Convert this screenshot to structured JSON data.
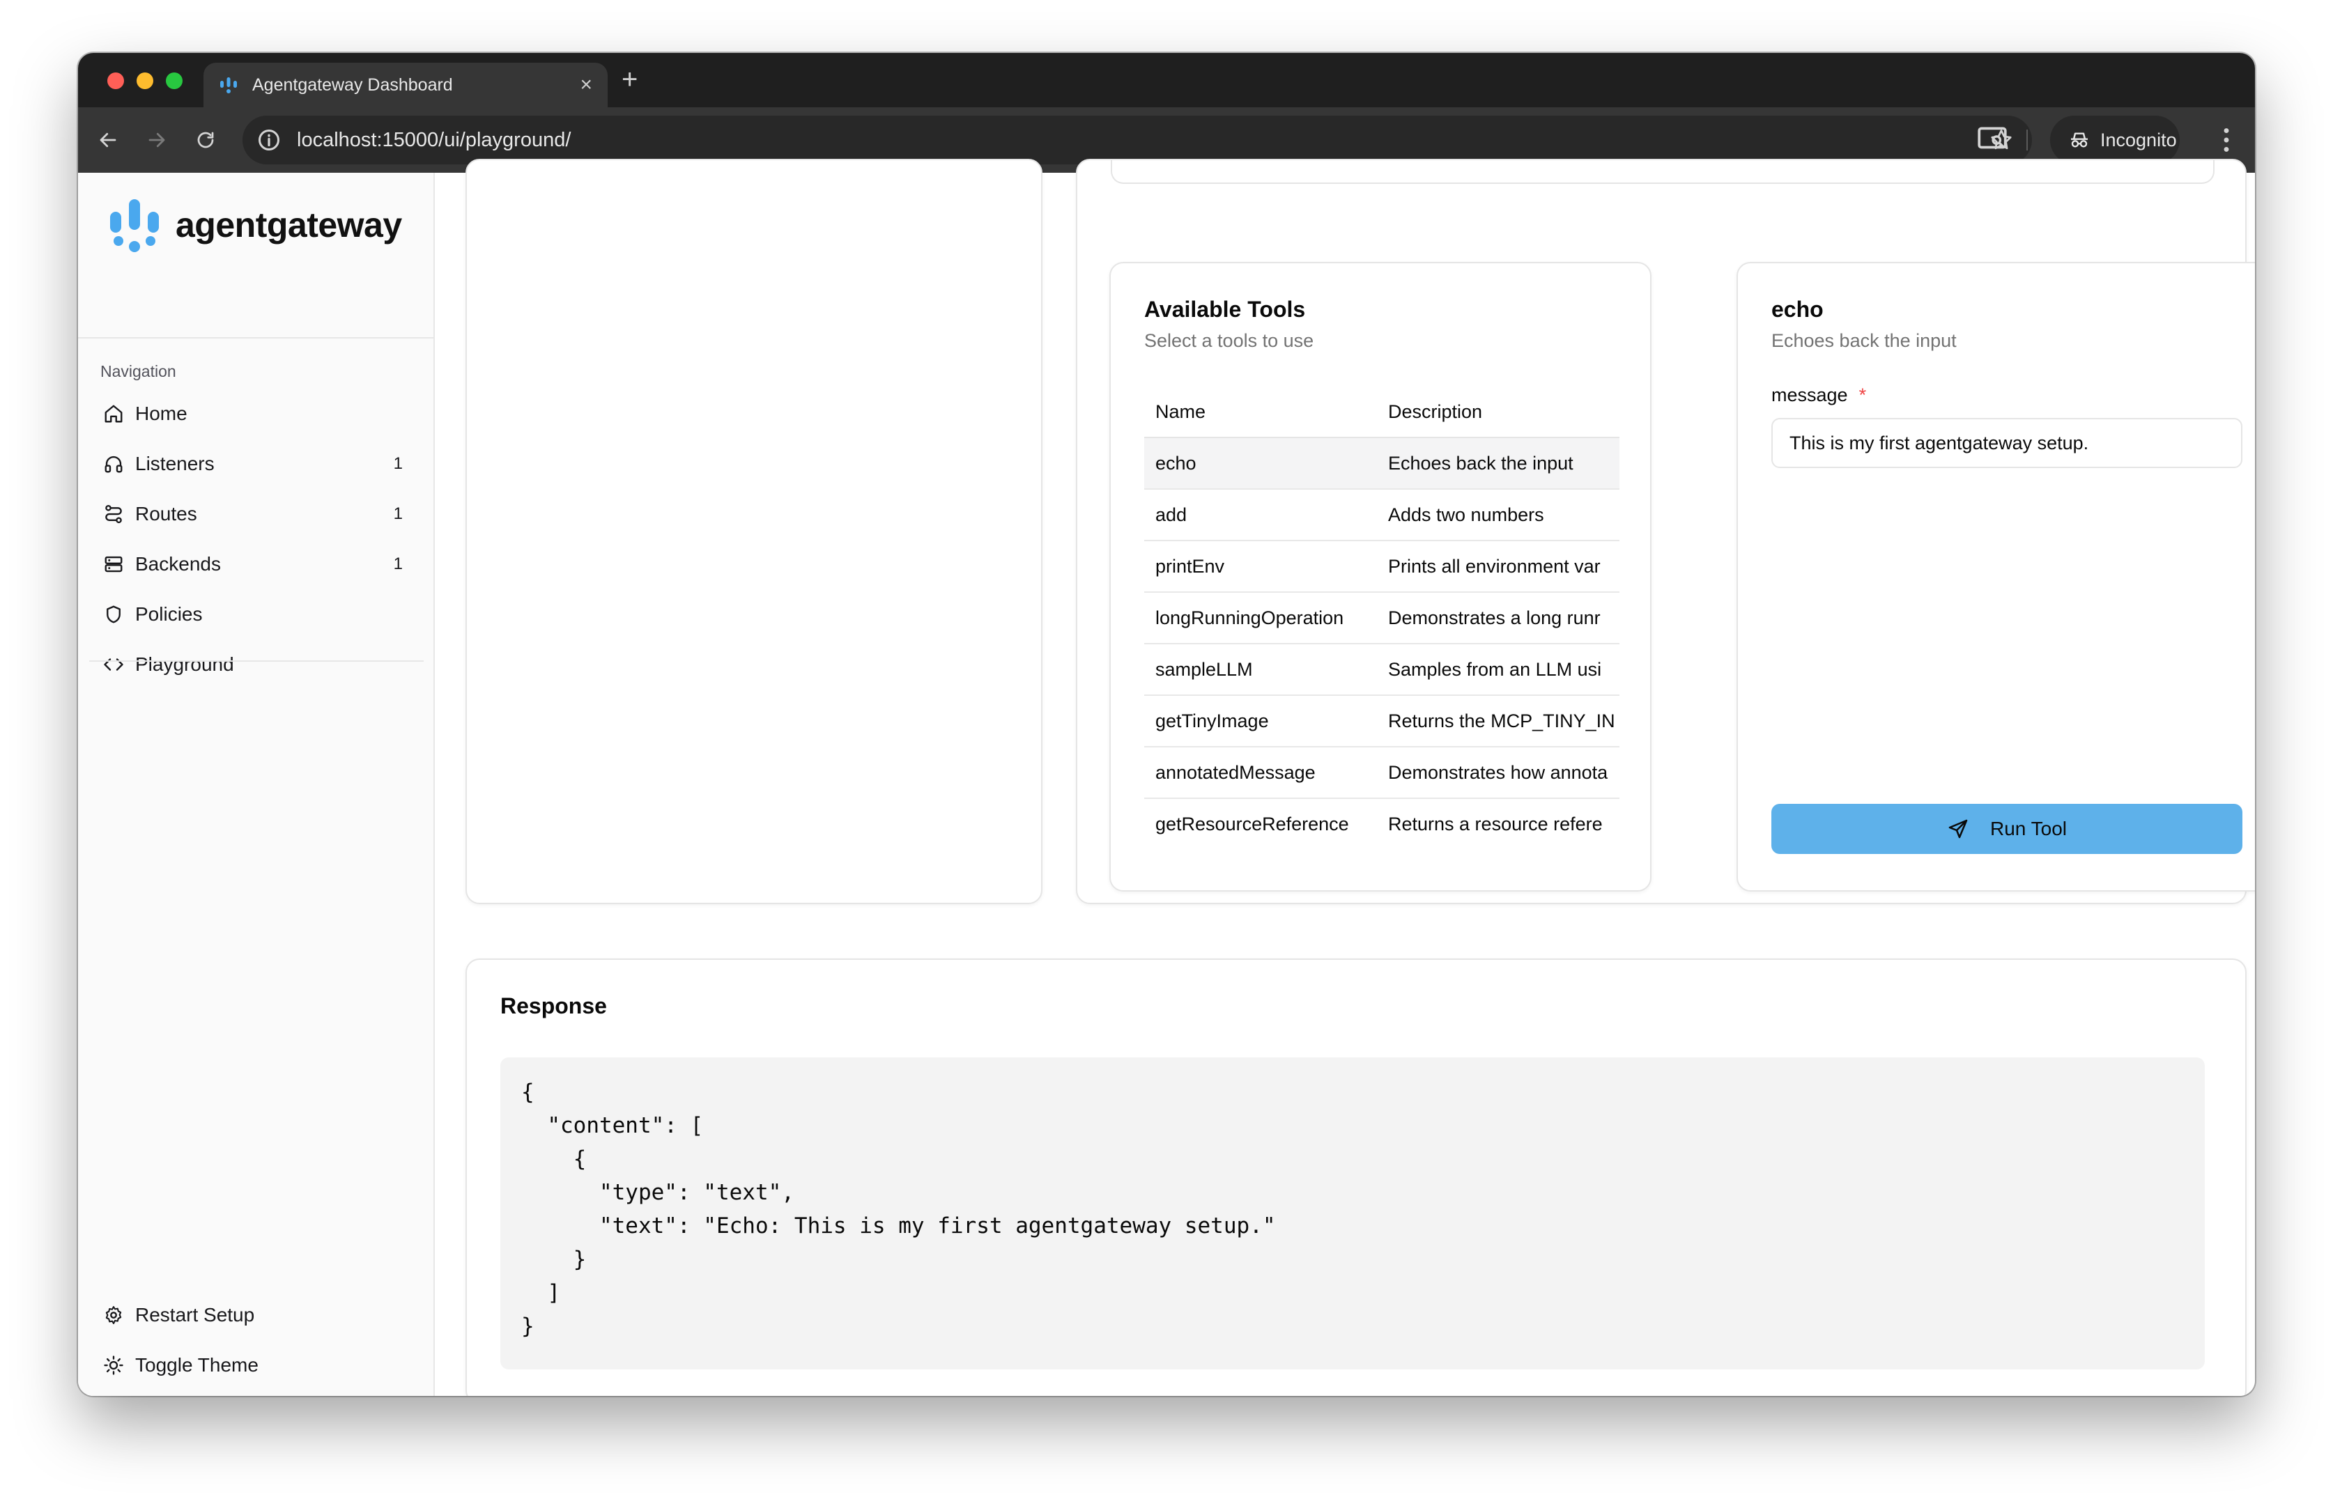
{
  "browser": {
    "tab_title": "Agentgateway Dashboard",
    "url": "localhost:15000/ui/playground/",
    "incognito_label": "Incognito"
  },
  "brand": {
    "name": "agentgateway",
    "color": "#4aa8ee"
  },
  "sidebar": {
    "section_label": "Navigation",
    "items": [
      {
        "label": "Home",
        "icon": "home-icon",
        "count": ""
      },
      {
        "label": "Listeners",
        "icon": "headphones-icon",
        "count": "1"
      },
      {
        "label": "Routes",
        "icon": "route-icon",
        "count": "1"
      },
      {
        "label": "Backends",
        "icon": "server-icon",
        "count": "1"
      },
      {
        "label": "Policies",
        "icon": "shield-icon",
        "count": ""
      },
      {
        "label": "Playground",
        "icon": "code-icon",
        "count": ""
      }
    ],
    "bottom_items": [
      {
        "label": "Restart Setup",
        "icon": "gear-icon"
      },
      {
        "label": "Toggle Theme",
        "icon": "sun-icon"
      }
    ]
  },
  "tools_panel": {
    "title": "Available Tools",
    "subtitle": "Select a tools to use",
    "columns": [
      "Name",
      "Description"
    ],
    "rows": [
      {
        "name": "echo",
        "description": "Echoes back the input",
        "selected": true
      },
      {
        "name": "add",
        "description": "Adds two numbers"
      },
      {
        "name": "printEnv",
        "description": "Prints all environment var"
      },
      {
        "name": "longRunningOperation",
        "description": "Demonstrates a long runr"
      },
      {
        "name": "sampleLLM",
        "description": "Samples from an LLM usi"
      },
      {
        "name": "getTinyImage",
        "description": "Returns the MCP_TINY_IN"
      },
      {
        "name": "annotatedMessage",
        "description": "Demonstrates how annota"
      },
      {
        "name": "getResourceReference",
        "description": "Returns a resource refere"
      }
    ]
  },
  "tool_form": {
    "title": "echo",
    "subtitle": "Echoes back the input",
    "field_label": "message",
    "required_mark": "*",
    "field_value": "This is my first agentgateway setup.",
    "run_label": "Run Tool",
    "accent": "#5eb1ea"
  },
  "response": {
    "title": "Response",
    "body": "{\n  \"content\": [\n    {\n      \"type\": \"text\",\n      \"text\": \"Echo: This is my first agentgateway setup.\"\n    }\n  ]\n}"
  }
}
